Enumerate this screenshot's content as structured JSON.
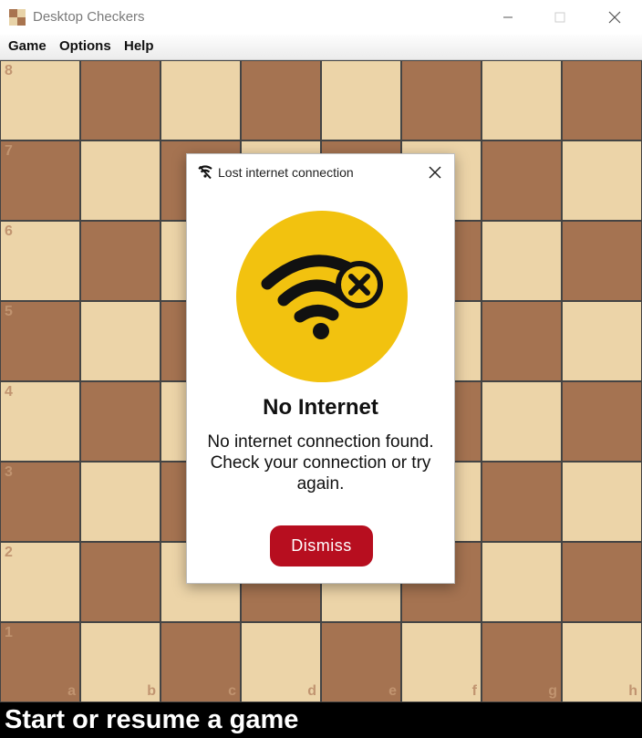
{
  "window": {
    "title": "Desktop Checkers"
  },
  "menu": {
    "items": [
      "Game",
      "Options",
      "Help"
    ]
  },
  "board": {
    "ranks": [
      "8",
      "7",
      "6",
      "5",
      "4",
      "3",
      "2",
      "1"
    ],
    "files": [
      "a",
      "b",
      "c",
      "d",
      "e",
      "f",
      "g",
      "h"
    ],
    "colors": {
      "light": "#ecd4a8",
      "dark": "#a57351",
      "label": "#c19470"
    }
  },
  "status": {
    "text": "Start or resume a game"
  },
  "dialog": {
    "title": "Lost internet connection",
    "heading": "No Internet",
    "message": "No internet connection found. Check your connection or try again.",
    "button_label": "Dismiss",
    "icon": "wifi-off-icon",
    "badge_color": "#f2c20f",
    "button_color": "#b70e1f"
  }
}
